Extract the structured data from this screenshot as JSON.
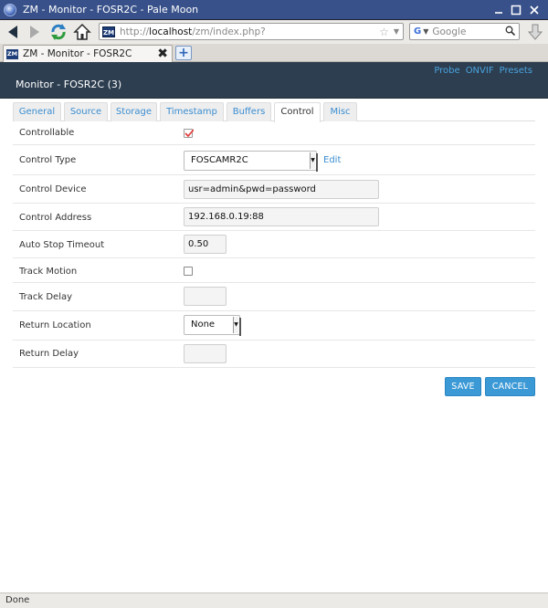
{
  "window": {
    "title": "ZM - Monitor - FOSR2C - Pale Moon"
  },
  "browser": {
    "url_scheme": "http://",
    "url_host": "localhost",
    "url_path": "/zm/index.php?",
    "search_engine_letter": "G",
    "search_placeholder": "Google",
    "tab_title": "ZM - Monitor - FOSR2C",
    "site_icon_text": "ZM"
  },
  "header": {
    "title": "Monitor - FOSR2C (3)",
    "links": [
      "Probe",
      "ONVIF",
      "Presets"
    ]
  },
  "tabs": [
    {
      "label": "General",
      "active": false
    },
    {
      "label": "Source",
      "active": false
    },
    {
      "label": "Storage",
      "active": false
    },
    {
      "label": "Timestamp",
      "active": false
    },
    {
      "label": "Buffers",
      "active": false
    },
    {
      "label": "Control",
      "active": true
    },
    {
      "label": "Misc",
      "active": false
    }
  ],
  "form": {
    "controllable": {
      "label": "Controllable",
      "checked": true
    },
    "control_type": {
      "label": "Control Type",
      "value": "FOSCAMR2C",
      "edit": "Edit"
    },
    "control_device": {
      "label": "Control Device",
      "value": "usr=admin&pwd=password"
    },
    "control_address": {
      "label": "Control Address",
      "value": "192.168.0.19:88"
    },
    "auto_stop_timeout": {
      "label": "Auto Stop Timeout",
      "value": "0.50"
    },
    "track_motion": {
      "label": "Track Motion",
      "checked": false
    },
    "track_delay": {
      "label": "Track Delay",
      "value": ""
    },
    "return_location": {
      "label": "Return Location",
      "value": "None"
    },
    "return_delay": {
      "label": "Return Delay",
      "value": ""
    }
  },
  "buttons": {
    "save": "SAVE",
    "cancel": "CANCEL"
  },
  "status": {
    "text": "Done"
  },
  "colors": {
    "header_bg": "#2d3e50",
    "link": "#3b8dd0",
    "button": "#3b99d6",
    "titlebar": "#38518a"
  }
}
